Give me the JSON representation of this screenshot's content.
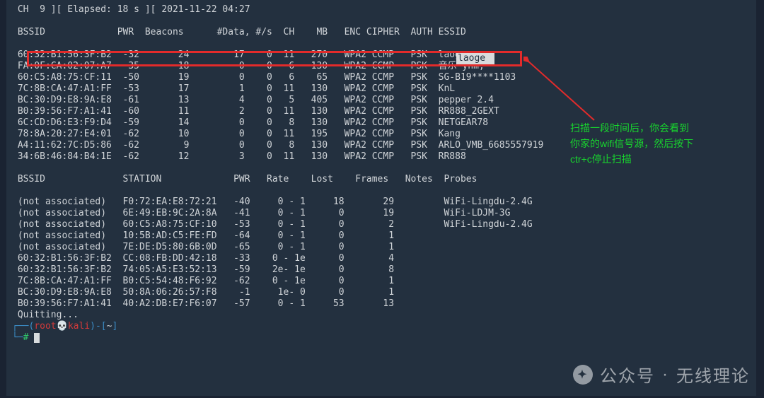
{
  "status_line": " CH  9 ][ Elapsed: 18 s ][ 2021-11-22 04:27",
  "ap_header": {
    "bssid": "BSSID",
    "pwr": "PWR",
    "beacons": "Beacons",
    "data": "#Data,",
    "ps": "#/s",
    "ch": "CH",
    "mb": "MB",
    "enc": "ENC",
    "cipher": "CIPHER",
    "auth": "AUTH",
    "essid": "ESSID"
  },
  "ap_rows": [
    {
      "bssid": "60:32:B1:56:3F:B2",
      "pwr": "-32",
      "beacons": "24",
      "data": "17",
      "ps": "0",
      "ch": "11",
      "mb": "270",
      "enc": "WPA2",
      "cipher": "CCMP",
      "auth": "PSK",
      "essid": "laoge",
      "hl": true
    },
    {
      "bssid": "FA:0F:CA:02:07:A7",
      "pwr": "-35",
      "beacons": "18",
      "data": "0",
      "ps": "0",
      "ch": "6",
      "mb": "130",
      "enc": "WPA2",
      "cipher": "CCMP",
      "auth": "PSK",
      "essid": "音乐·ynm,"
    },
    {
      "bssid": "60:C5:A8:75:CF:11",
      "pwr": "-50",
      "beacons": "19",
      "data": "0",
      "ps": "0",
      "ch": "6",
      "mb": "65",
      "enc": "WPA2",
      "cipher": "CCMP",
      "auth": "PSK",
      "essid": "SG-B19****1103"
    },
    {
      "bssid": "7C:8B:CA:47:A1:FF",
      "pwr": "-53",
      "beacons": "17",
      "data": "1",
      "ps": "0",
      "ch": "11",
      "mb": "130",
      "enc": "WPA2",
      "cipher": "CCMP",
      "auth": "PSK",
      "essid": "KnL"
    },
    {
      "bssid": "BC:30:D9:E8:9A:E8",
      "pwr": "-61",
      "beacons": "13",
      "data": "4",
      "ps": "0",
      "ch": "5",
      "mb": "405",
      "enc": "WPA2",
      "cipher": "CCMP",
      "auth": "PSK",
      "essid": "pepper 2.4"
    },
    {
      "bssid": "B0:39:56:F7:A1:41",
      "pwr": "-60",
      "beacons": "11",
      "data": "2",
      "ps": "0",
      "ch": "11",
      "mb": "130",
      "enc": "WPA2",
      "cipher": "CCMP",
      "auth": "PSK",
      "essid": "RR888_2GEXT"
    },
    {
      "bssid": "6C:CD:D6:E3:F9:D4",
      "pwr": "-59",
      "beacons": "14",
      "data": "0",
      "ps": "0",
      "ch": "8",
      "mb": "130",
      "enc": "WPA2",
      "cipher": "CCMP",
      "auth": "PSK",
      "essid": "NETGEAR78"
    },
    {
      "bssid": "78:8A:20:27:E4:01",
      "pwr": "-62",
      "beacons": "10",
      "data": "0",
      "ps": "0",
      "ch": "11",
      "mb": "195",
      "enc": "WPA2",
      "cipher": "CCMP",
      "auth": "PSK",
      "essid": "Kang"
    },
    {
      "bssid": "A4:11:62:7C:D5:86",
      "pwr": "-62",
      "beacons": "9",
      "data": "0",
      "ps": "0",
      "ch": "8",
      "mb": "130",
      "enc": "WPA2",
      "cipher": "CCMP",
      "auth": "PSK",
      "essid": "ARLO_VMB_6685557919"
    },
    {
      "bssid": "34:6B:46:84:B4:1E",
      "pwr": "-62",
      "beacons": "12",
      "data": "3",
      "ps": "0",
      "ch": "11",
      "mb": "130",
      "enc": "WPA2",
      "cipher": "CCMP",
      "auth": "PSK",
      "essid": "RR888"
    }
  ],
  "client_header": {
    "bssid": "BSSID",
    "station": "STATION",
    "pwr": "PWR",
    "rate": "Rate",
    "lost": "Lost",
    "frames": "Frames",
    "notes": "Notes",
    "probes": "Probes"
  },
  "client_rows": [
    {
      "bssid": "(not associated)",
      "station": "F0:72:EA:E8:72:21",
      "pwr": "-40",
      "rate": "0 - 1",
      "lost": "18",
      "frames": "29",
      "notes": "",
      "probes": "WiFi-Lingdu-2.4G"
    },
    {
      "bssid": "(not associated)",
      "station": "6E:49:EB:9C:2A:8A",
      "pwr": "-41",
      "rate": "0 - 1",
      "lost": "0",
      "frames": "19",
      "notes": "",
      "probes": "WiFi-LDJM-3G"
    },
    {
      "bssid": "(not associated)",
      "station": "60:C5:A8:75:CF:10",
      "pwr": "-53",
      "rate": "0 - 1",
      "lost": "0",
      "frames": "2",
      "notes": "",
      "probes": "WiFi-Lingdu-2.4G"
    },
    {
      "bssid": "(not associated)",
      "station": "10:5B:AD:C5:FE:FD",
      "pwr": "-64",
      "rate": "0 - 1",
      "lost": "0",
      "frames": "1",
      "notes": "",
      "probes": ""
    },
    {
      "bssid": "(not associated)",
      "station": "7E:DE:D5:80:6B:0D",
      "pwr": "-65",
      "rate": "0 - 1",
      "lost": "0",
      "frames": "1",
      "notes": "",
      "probes": ""
    },
    {
      "bssid": "60:32:B1:56:3F:B2",
      "station": "CC:08:FB:DD:42:18",
      "pwr": "-33",
      "rate": "0 - 1e",
      "lost": "0",
      "frames": "4",
      "notes": "",
      "probes": ""
    },
    {
      "bssid": "60:32:B1:56:3F:B2",
      "station": "74:05:A5:E3:52:13",
      "pwr": "-59",
      "rate": "2e- 1e",
      "lost": "0",
      "frames": "8",
      "notes": "",
      "probes": ""
    },
    {
      "bssid": "7C:8B:CA:47:A1:FF",
      "station": "B0:C5:54:48:F6:92",
      "pwr": "-62",
      "rate": "0 - 1e",
      "lost": "0",
      "frames": "1",
      "notes": "",
      "probes": ""
    },
    {
      "bssid": "BC:30:D9:E8:9A:E8",
      "station": "50:8A:06:26:57:F8",
      "pwr": "-1",
      "rate": "1e- 0",
      "lost": "0",
      "frames": "1",
      "notes": "",
      "probes": ""
    },
    {
      "bssid": "B0:39:56:F7:A1:41",
      "station": "40:A2:DB:E7:F6:07",
      "pwr": "-57",
      "rate": "0 - 1",
      "lost": "53",
      "frames": "13",
      "notes": "",
      "probes": ""
    }
  ],
  "quitting": "Quitting...",
  "prompt": {
    "user": "root",
    "host": "kali",
    "path": "~",
    "skull": "💀"
  },
  "annotation_lines": [
    "扫描一段时间后，你会看到",
    "你家的wifi信号源，然后按下",
    "ctr+c停止扫描"
  ],
  "watermark": {
    "prefix": "公众号",
    "sep": "·",
    "name": "无线理论"
  }
}
